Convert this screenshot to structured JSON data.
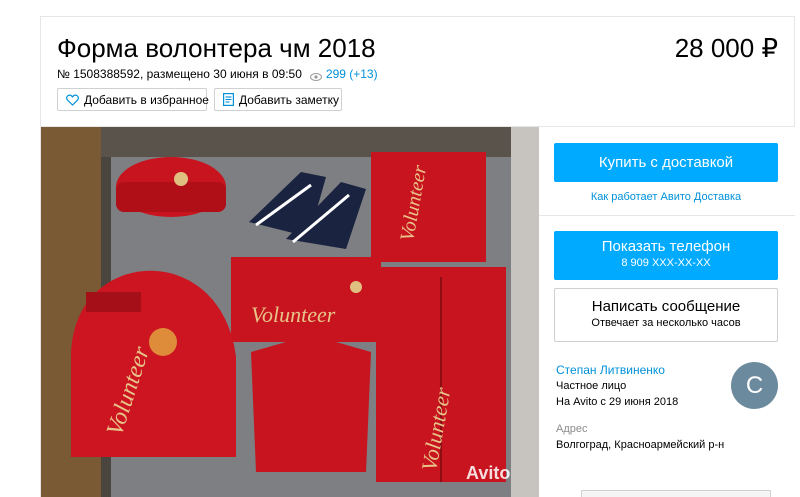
{
  "listing": {
    "title": "Форма волонтера чм 2018",
    "price": "28 000 ₽",
    "meta_text": "№ 1508388592, размещено 30 июня в 09:50",
    "views": "299 (+13)"
  },
  "actions": {
    "favorite_label": "Добавить в избранное",
    "note_label": "Добавить заметку"
  },
  "photo": {
    "watermark": "Avito",
    "item_text": "Volunteer"
  },
  "sidebar": {
    "buy_label": "Купить с доставкой",
    "delivery_link": "Как работает Авито Доставка",
    "phone_label": "Показать телефон",
    "phone_number": "8 909 XXX-XX-XX",
    "message_label": "Написать сообщение",
    "message_sub": "Отвечает за несколько часов"
  },
  "seller": {
    "name": "Степан Литвиненко",
    "type": "Частное лицо",
    "since": "На Avito с 29 июня 2018",
    "avatar_letter": "С"
  },
  "address": {
    "label": "Адрес",
    "value": "Волгоград, Красноармейский р-н"
  },
  "colors": {
    "accent": "#00aaff",
    "link": "#0091d9",
    "product_red": "#c8141e"
  },
  "icons": [
    "heart-icon",
    "note-icon",
    "eye-icon"
  ]
}
